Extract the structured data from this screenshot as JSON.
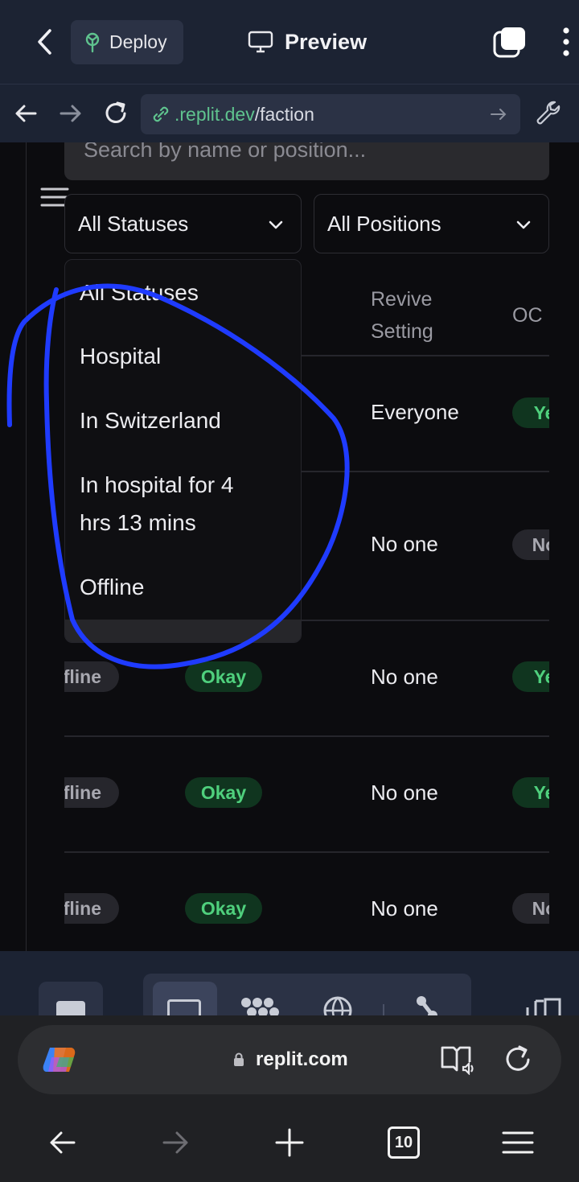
{
  "topbar": {
    "deploy_label": "Deploy",
    "preview_label": "Preview"
  },
  "urlbar": {
    "url_host": ".replit.dev",
    "url_path": "/faction"
  },
  "page": {
    "search_placeholder": "Search by name or position...",
    "status_filter": "All Statuses",
    "position_filter": "All Positions",
    "columns": {
      "revive": [
        "Revive",
        "Setting"
      ],
      "oc": "OC"
    },
    "rows": [
      {
        "revive": "Everyone",
        "oc": "Ye",
        "oc_color": "green"
      },
      {
        "revive": "No one",
        "oc": "No",
        "oc_color": "gray"
      },
      {
        "status": "fline",
        "life": "Okay",
        "revive": "No one",
        "oc": "Ye",
        "oc_color": "green"
      },
      {
        "status": "fline",
        "life": "Okay",
        "revive": "No one",
        "oc": "Ye",
        "oc_color": "green"
      },
      {
        "status": "fline",
        "life": "Okay",
        "revive": "No one",
        "oc": "No",
        "oc_color": "gray"
      }
    ],
    "status_dropdown": [
      "All Statuses",
      "Hospital",
      "In Switzerland",
      "In hospital for 4",
      "hrs 13 mins",
      "Offline"
    ]
  },
  "browser": {
    "host": "replit.com",
    "tab_count": "10"
  },
  "colors": {
    "replit_bar": "#1c2333",
    "page_bg": "#0c0c0f",
    "annotation_stroke": "#1f3bff",
    "okay_green": "#4fd07d"
  }
}
